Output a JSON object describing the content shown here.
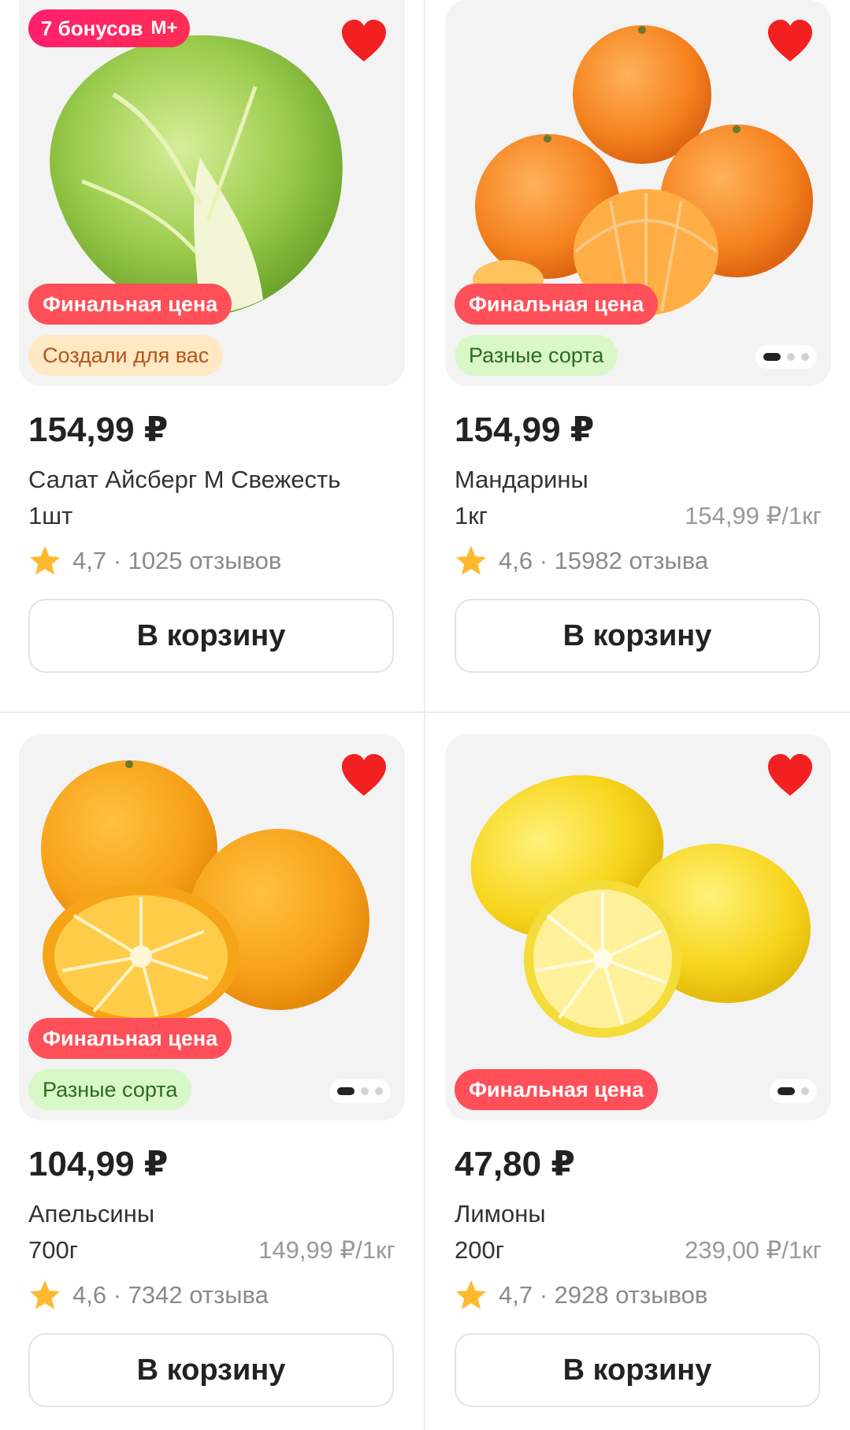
{
  "currency": "₽",
  "products": [
    {
      "bonus": {
        "text": "7 бонусов",
        "mark": "M+"
      },
      "badges": [
        "Финальная цена",
        "Создали для вас"
      ],
      "price": "154,99 ₽",
      "name": "Салат Айсберг М Свежесть",
      "unit": "1шт",
      "unit_price": "",
      "rating": "4,7 · 1025 отзывов",
      "cart_label": "В корзину",
      "image_icon": "iceberg-lettuce"
    },
    {
      "badges": [
        "Финальная цена",
        "Разные сорта"
      ],
      "price": "154,99 ₽",
      "name": "Мандарины",
      "unit": "1кг",
      "unit_price": "154,99 ₽/1кг",
      "rating": "4,6 · 15982 отзыва",
      "cart_label": "В корзину",
      "image_icon": "tangerines",
      "carousel": {
        "count": 3,
        "active": 0
      }
    },
    {
      "badges": [
        "Финальная цена",
        "Разные сорта"
      ],
      "price": "104,99 ₽",
      "name": "Апельсины",
      "unit": "700г",
      "unit_price": "149,99 ₽/1кг",
      "rating": "4,6 · 7342 отзыва",
      "cart_label": "В корзину",
      "image_icon": "oranges",
      "carousel": {
        "count": 3,
        "active": 0
      }
    },
    {
      "badges": [
        "Финальная цена"
      ],
      "price": "47,80 ₽",
      "name": "Лимоны",
      "unit": "200г",
      "unit_price": "239,00 ₽/1кг",
      "rating": "4,7 · 2928 отзывов",
      "cart_label": "В корзину",
      "image_icon": "lemons",
      "carousel": {
        "count": 2,
        "active": 0
      }
    }
  ],
  "colors": {
    "final_badge": "#ff4f58",
    "heart": "#f22020",
    "star": "#ffb92e",
    "bonus": "#ff1f6e"
  }
}
